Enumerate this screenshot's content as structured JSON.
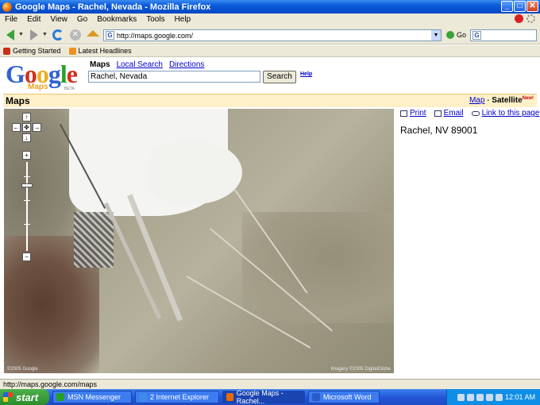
{
  "window": {
    "title": "Google Maps - Rachel, Nevada - Mozilla Firefox",
    "buttons": {
      "minimize": "_",
      "maximize": "□",
      "close": "✕"
    }
  },
  "menu": [
    "File",
    "Edit",
    "View",
    "Go",
    "Bookmarks",
    "Tools",
    "Help"
  ],
  "toolbar": {
    "url": "http://maps.google.com/",
    "go_label": "Go",
    "search_value": ""
  },
  "bookmarks": [
    {
      "label": "Getting Started",
      "icon": "bookmark-red-icon"
    },
    {
      "label": "Latest Headlines",
      "icon": "rss-icon"
    }
  ],
  "google": {
    "logo_letters": [
      "G",
      "o",
      "o",
      "g",
      "l",
      "e"
    ],
    "logo_sub": "Maps",
    "logo_beta": "BETA",
    "nav": {
      "current": "Maps",
      "links": [
        "Local Search",
        "Directions"
      ]
    },
    "query": "Rachel, Nevada",
    "search_button": "Search",
    "help": "Help"
  },
  "mapbar": {
    "title": "Maps",
    "map_link": "Map",
    "separator": " - ",
    "satellite": "Satellite",
    "new_badge": "New!"
  },
  "map": {
    "controls": {
      "up": "↑",
      "left": "←",
      "center": "✥",
      "right": "→",
      "down": "↓",
      "zoom_in": "+",
      "zoom_out": "−"
    },
    "zoom_level_fraction": 0.27,
    "copyright_left": "©2005 Google",
    "copyright_right": "Imagery ©2005 DigitalGlobe"
  },
  "side": {
    "actions": [
      {
        "label": "Print",
        "icon": "print-icon"
      },
      {
        "label": "Email",
        "icon": "email-icon"
      },
      {
        "label": "Link to this page",
        "icon": "link-icon"
      }
    ],
    "address": "Rachel, NV 89001"
  },
  "status": "http://maps.google.com/maps",
  "taskbar": {
    "start": "start",
    "tasks": [
      {
        "label": "MSN Messenger",
        "color": "#28a028"
      },
      {
        "label": "2 Internet Explorer",
        "color": "#3c8ce8"
      },
      {
        "label": "Google Maps - Rachel...",
        "color": "#e86a00",
        "active": true
      },
      {
        "label": "Microsoft Word",
        "color": "#2a5cc8"
      }
    ],
    "clock": "12:01 AM"
  },
  "colors": {
    "accent": "#0000cc",
    "yellowbar": "#fff0c8",
    "taskbar": "#2456d8"
  }
}
